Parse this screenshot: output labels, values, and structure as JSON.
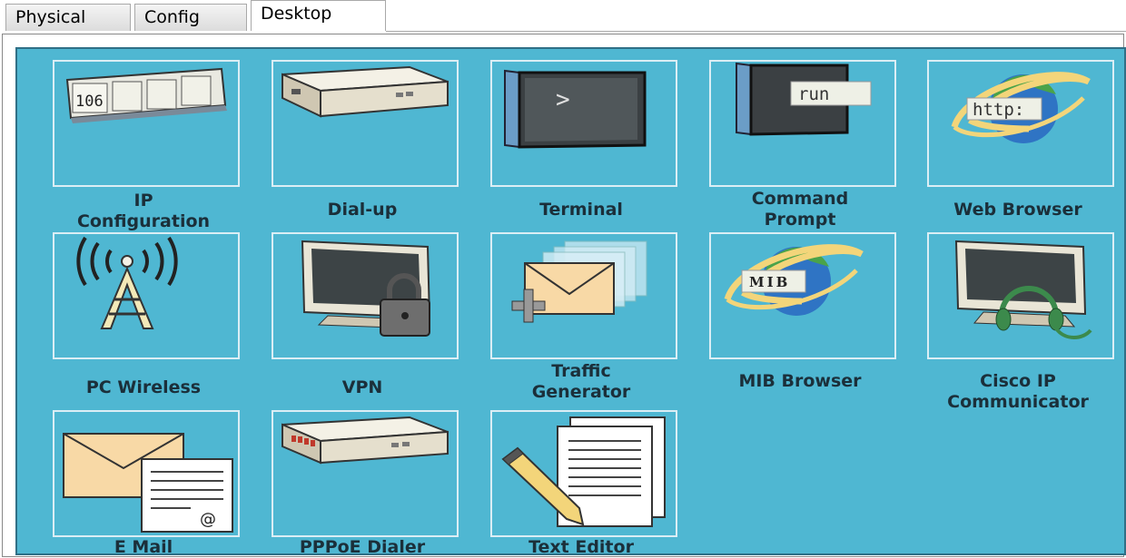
{
  "tabs": [
    {
      "label": "Physical"
    },
    {
      "label": "Config"
    },
    {
      "label": "Desktop",
      "active": true
    }
  ],
  "apps": [
    {
      "label": "IP Configuration",
      "line1": "IP",
      "line2": "Configuration",
      "icon": "ip-config-icon",
      "icon_text": "106"
    },
    {
      "label": "Dial-up",
      "icon": "dialup-modem-icon"
    },
    {
      "label": "Terminal",
      "icon": "terminal-icon",
      "icon_text": ">"
    },
    {
      "label": "Command Prompt",
      "line1": "Command",
      "line2": "Prompt",
      "icon": "command-prompt-icon",
      "icon_text": "run"
    },
    {
      "label": "Web Browser",
      "icon": "web-browser-icon",
      "icon_text": "http:"
    },
    {
      "label": "PC Wireless",
      "icon": "wireless-tower-icon"
    },
    {
      "label": "VPN",
      "icon": "vpn-lock-icon"
    },
    {
      "label": "Traffic Generator",
      "line1": "Traffic",
      "line2": "Generator",
      "icon": "traffic-generator-icon"
    },
    {
      "label": "MIB Browser",
      "icon": "mib-browser-icon",
      "icon_text": "MIB"
    },
    {
      "label": "Cisco IP Communicator",
      "line1": "Cisco IP",
      "line2": "Communicator",
      "icon": "headset-monitor-icon"
    },
    {
      "label": "E Mail",
      "icon": "email-icon",
      "icon_text": "@"
    },
    {
      "label": "PPPoE Dialer",
      "icon": "pppoe-dialer-icon"
    },
    {
      "label": "Text Editor",
      "icon": "text-editor-icon"
    }
  ],
  "colors": {
    "panel_bg": "#4fb7d2",
    "tile_border": "#dbeef5",
    "label_text": "#1b2f3a"
  }
}
